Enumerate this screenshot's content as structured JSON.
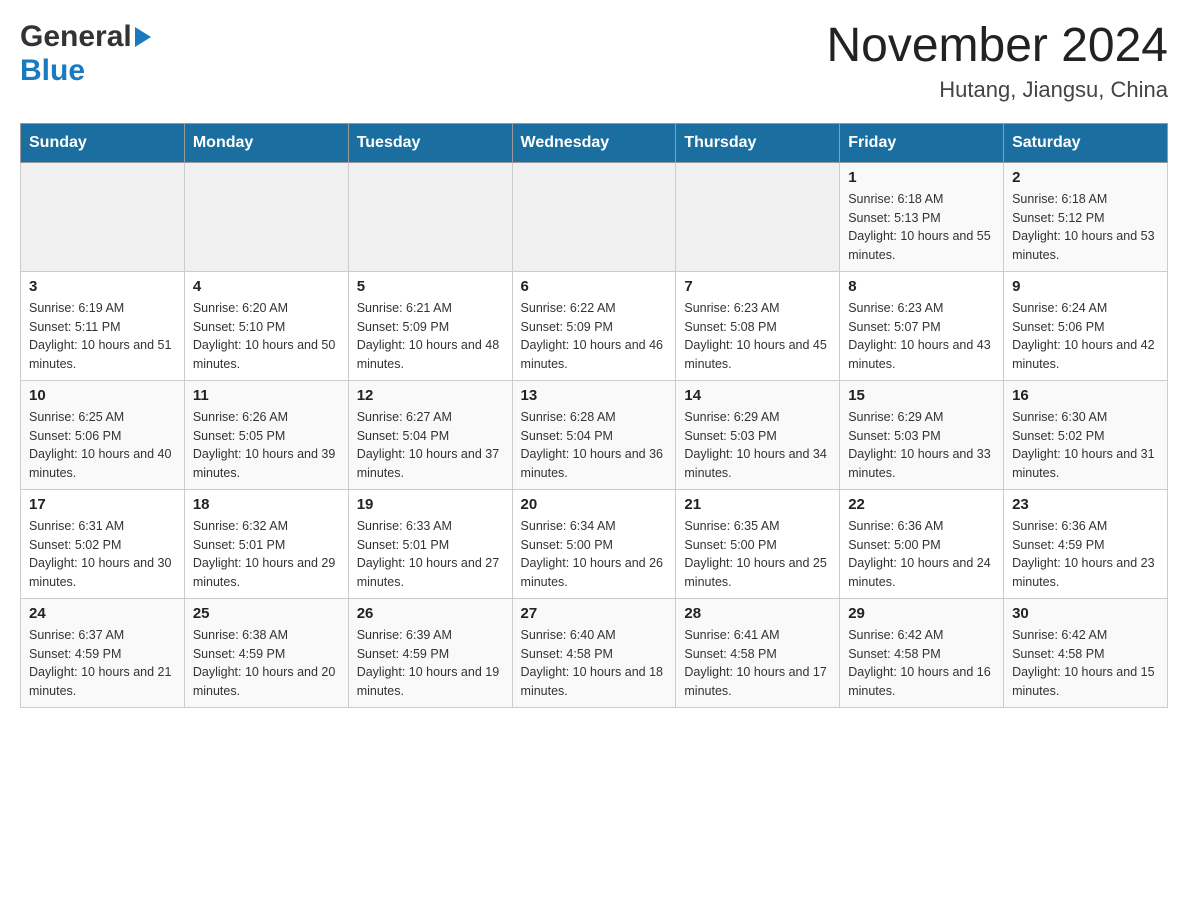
{
  "header": {
    "logo_general": "General",
    "logo_blue": "Blue",
    "month_year": "November 2024",
    "location": "Hutang, Jiangsu, China"
  },
  "days_of_week": [
    "Sunday",
    "Monday",
    "Tuesday",
    "Wednesday",
    "Thursday",
    "Friday",
    "Saturday"
  ],
  "weeks": [
    {
      "cells": [
        {
          "day": "",
          "info": ""
        },
        {
          "day": "",
          "info": ""
        },
        {
          "day": "",
          "info": ""
        },
        {
          "day": "",
          "info": ""
        },
        {
          "day": "",
          "info": ""
        },
        {
          "day": "1",
          "info": "Sunrise: 6:18 AM\nSunset: 5:13 PM\nDaylight: 10 hours and 55 minutes."
        },
        {
          "day": "2",
          "info": "Sunrise: 6:18 AM\nSunset: 5:12 PM\nDaylight: 10 hours and 53 minutes."
        }
      ]
    },
    {
      "cells": [
        {
          "day": "3",
          "info": "Sunrise: 6:19 AM\nSunset: 5:11 PM\nDaylight: 10 hours and 51 minutes."
        },
        {
          "day": "4",
          "info": "Sunrise: 6:20 AM\nSunset: 5:10 PM\nDaylight: 10 hours and 50 minutes."
        },
        {
          "day": "5",
          "info": "Sunrise: 6:21 AM\nSunset: 5:09 PM\nDaylight: 10 hours and 48 minutes."
        },
        {
          "day": "6",
          "info": "Sunrise: 6:22 AM\nSunset: 5:09 PM\nDaylight: 10 hours and 46 minutes."
        },
        {
          "day": "7",
          "info": "Sunrise: 6:23 AM\nSunset: 5:08 PM\nDaylight: 10 hours and 45 minutes."
        },
        {
          "day": "8",
          "info": "Sunrise: 6:23 AM\nSunset: 5:07 PM\nDaylight: 10 hours and 43 minutes."
        },
        {
          "day": "9",
          "info": "Sunrise: 6:24 AM\nSunset: 5:06 PM\nDaylight: 10 hours and 42 minutes."
        }
      ]
    },
    {
      "cells": [
        {
          "day": "10",
          "info": "Sunrise: 6:25 AM\nSunset: 5:06 PM\nDaylight: 10 hours and 40 minutes."
        },
        {
          "day": "11",
          "info": "Sunrise: 6:26 AM\nSunset: 5:05 PM\nDaylight: 10 hours and 39 minutes."
        },
        {
          "day": "12",
          "info": "Sunrise: 6:27 AM\nSunset: 5:04 PM\nDaylight: 10 hours and 37 minutes."
        },
        {
          "day": "13",
          "info": "Sunrise: 6:28 AM\nSunset: 5:04 PM\nDaylight: 10 hours and 36 minutes."
        },
        {
          "day": "14",
          "info": "Sunrise: 6:29 AM\nSunset: 5:03 PM\nDaylight: 10 hours and 34 minutes."
        },
        {
          "day": "15",
          "info": "Sunrise: 6:29 AM\nSunset: 5:03 PM\nDaylight: 10 hours and 33 minutes."
        },
        {
          "day": "16",
          "info": "Sunrise: 6:30 AM\nSunset: 5:02 PM\nDaylight: 10 hours and 31 minutes."
        }
      ]
    },
    {
      "cells": [
        {
          "day": "17",
          "info": "Sunrise: 6:31 AM\nSunset: 5:02 PM\nDaylight: 10 hours and 30 minutes."
        },
        {
          "day": "18",
          "info": "Sunrise: 6:32 AM\nSunset: 5:01 PM\nDaylight: 10 hours and 29 minutes."
        },
        {
          "day": "19",
          "info": "Sunrise: 6:33 AM\nSunset: 5:01 PM\nDaylight: 10 hours and 27 minutes."
        },
        {
          "day": "20",
          "info": "Sunrise: 6:34 AM\nSunset: 5:00 PM\nDaylight: 10 hours and 26 minutes."
        },
        {
          "day": "21",
          "info": "Sunrise: 6:35 AM\nSunset: 5:00 PM\nDaylight: 10 hours and 25 minutes."
        },
        {
          "day": "22",
          "info": "Sunrise: 6:36 AM\nSunset: 5:00 PM\nDaylight: 10 hours and 24 minutes."
        },
        {
          "day": "23",
          "info": "Sunrise: 6:36 AM\nSunset: 4:59 PM\nDaylight: 10 hours and 23 minutes."
        }
      ]
    },
    {
      "cells": [
        {
          "day": "24",
          "info": "Sunrise: 6:37 AM\nSunset: 4:59 PM\nDaylight: 10 hours and 21 minutes."
        },
        {
          "day": "25",
          "info": "Sunrise: 6:38 AM\nSunset: 4:59 PM\nDaylight: 10 hours and 20 minutes."
        },
        {
          "day": "26",
          "info": "Sunrise: 6:39 AM\nSunset: 4:59 PM\nDaylight: 10 hours and 19 minutes."
        },
        {
          "day": "27",
          "info": "Sunrise: 6:40 AM\nSunset: 4:58 PM\nDaylight: 10 hours and 18 minutes."
        },
        {
          "day": "28",
          "info": "Sunrise: 6:41 AM\nSunset: 4:58 PM\nDaylight: 10 hours and 17 minutes."
        },
        {
          "day": "29",
          "info": "Sunrise: 6:42 AM\nSunset: 4:58 PM\nDaylight: 10 hours and 16 minutes."
        },
        {
          "day": "30",
          "info": "Sunrise: 6:42 AM\nSunset: 4:58 PM\nDaylight: 10 hours and 15 minutes."
        }
      ]
    }
  ]
}
